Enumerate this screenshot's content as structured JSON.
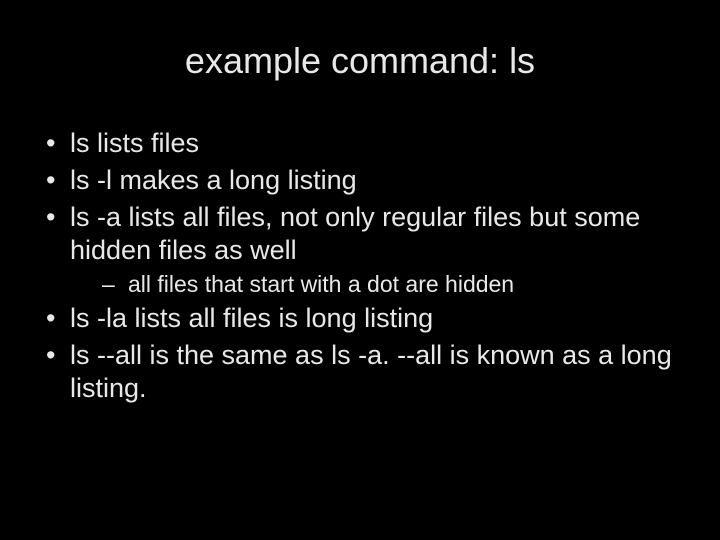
{
  "title": "example command: ls",
  "bullets": {
    "b0": "ls lists files",
    "b1": "ls -l makes a long listing",
    "b2": "ls -a lists all files, not only regular files but some hidden files as well",
    "b2_sub0": "all files that start with a dot are hidden",
    "b3": "ls -la lists all files is long listing",
    "b4": "ls --all is the same as ls -a. --all is known as a long listing."
  }
}
